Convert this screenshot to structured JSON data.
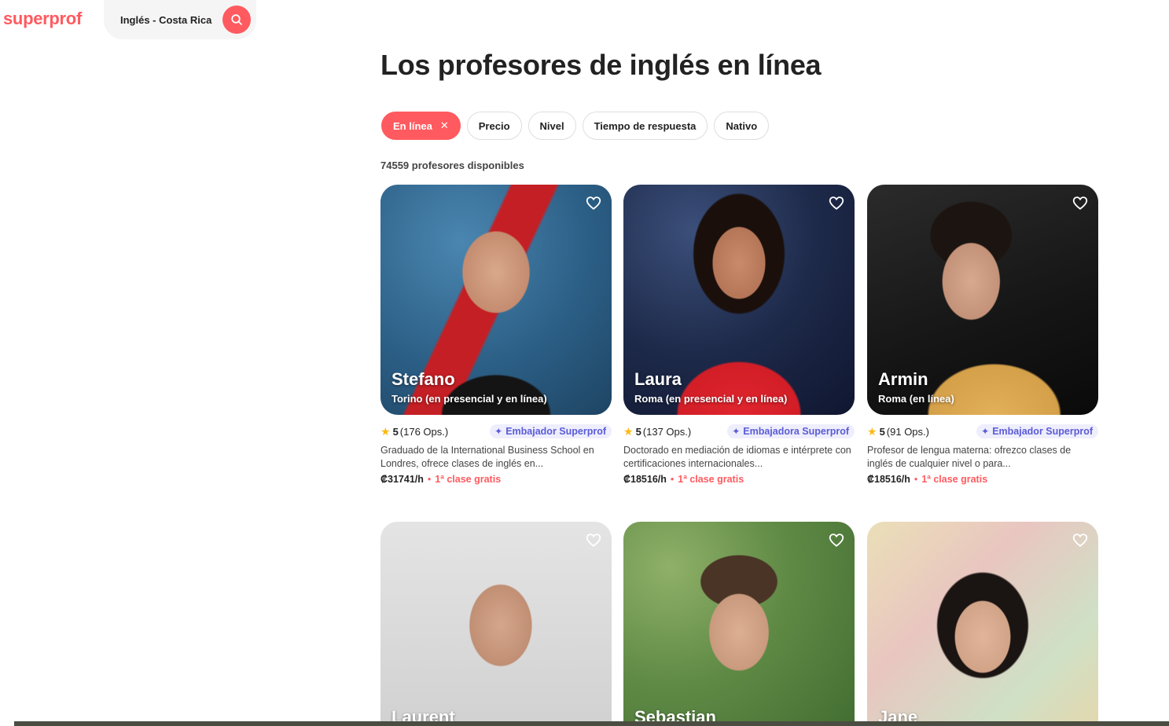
{
  "header": {
    "logo": "superprof",
    "search_value": "Inglés - Costa Rica"
  },
  "page": {
    "title": "Los profesores de inglés en línea",
    "count": "74559 profesores disponibles"
  },
  "filters": [
    {
      "label": "En línea",
      "active": true
    },
    {
      "label": "Precio"
    },
    {
      "label": "Nivel"
    },
    {
      "label": "Tiempo de respuesta"
    },
    {
      "label": "Nativo"
    }
  ],
  "icons": {
    "remove_filter": "close-icon",
    "search": "search-icon",
    "favorite": "heart-icon",
    "rating": "star-icon",
    "ambassador": "sparkle-icon"
  },
  "colors": {
    "brand": "#ff5a5f",
    "badge_bg": "#eeeefd",
    "badge_text": "#5b5bd6",
    "star": "#fdb913"
  },
  "tutors": [
    {
      "name": "Stefano",
      "location": "Torino (en presencial y en línea)",
      "rating": "5",
      "reviews": "(176 Ops.)",
      "badge": "Embajador Superprof",
      "description": "Graduado de la International Business School en Londres, ofrece clases de inglés en...",
      "price": "₡31741/h",
      "free_class": "1ª clase gratis"
    },
    {
      "name": "Laura",
      "location": "Roma (en presencial y en línea)",
      "rating": "5",
      "reviews": "(137 Ops.)",
      "badge": "Embajadora Superprof",
      "description": "Doctorado en mediación de idiomas e intérprete con certificaciones internacionales...",
      "price": "₡18516/h",
      "free_class": "1ª clase gratis"
    },
    {
      "name": "Armin",
      "location": "Roma (en línea)",
      "rating": "5",
      "reviews": "(91 Ops.)",
      "badge": "Embajador Superprof",
      "description": "Profesor de lengua materna: ofrezco clases de inglés de cualquier nivel o para...",
      "price": "₡18516/h",
      "free_class": "1ª clase gratis"
    },
    {
      "name": "Laurent"
    },
    {
      "name": "Sebastian"
    },
    {
      "name": "Jane"
    }
  ]
}
